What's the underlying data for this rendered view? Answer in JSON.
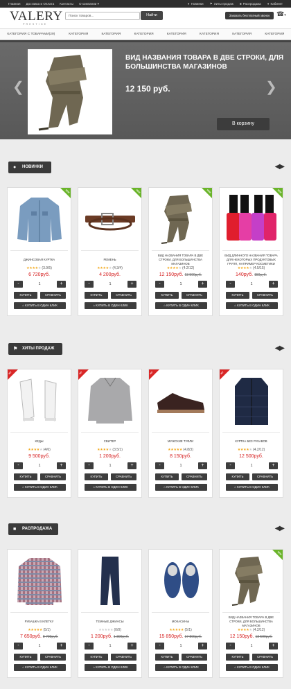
{
  "topbar": {
    "links": [
      "Главная",
      "Доставка и Оплата",
      "Контакты",
      "О компании ▾"
    ],
    "right": [
      "Новинки",
      "Хиты продаж",
      "Распродажа",
      "Кабинет"
    ]
  },
  "header": {
    "logo": "VALERY",
    "logo_sub": "PRESTIGE",
    "search_placeholder": "Поиск товаров...",
    "search_button": "Найти",
    "callback": "Заказать бесплатный звонок"
  },
  "nav": [
    "КАТЕГОРИЯ С ТОВАРАМИ(29)",
    "КАТЕГОРИЯ",
    "КАТЕГОРИЯ",
    "КАТЕГОРИЯ",
    "КАТЕГОРИЯ",
    "КАТЕГОРИЯ",
    "КАТЕГОРИЯ",
    "КАТЕГОРИЯ"
  ],
  "hero": {
    "title": "ВИД НАЗВАНИЯ ТОВАРА В ДВЕ СТРОКИ, ДЛЯ БОЛЬШИНСТВА МАГАЗИНОВ",
    "price": "12 150 руб.",
    "button": "В корзину"
  },
  "labels": {
    "minus": "-",
    "plus": "+",
    "buy": "КУПИТЬ",
    "compare": "СРАВНИТЬ",
    "one_click": "КУПИТЬ В ОДИН КЛИК",
    "new": "NEW",
    "hit": "HIT"
  },
  "sections": [
    {
      "title": "НОВИНКИ",
      "icon": "bell-icon",
      "ribbon": "new",
      "products": [
        {
          "name": "ДЖИНСОВАЯ КУРТКА",
          "stars": 4,
          "rating": "(3.9/5)",
          "price": "6 720руб.",
          "old": "",
          "qty": "1",
          "img": "jacket",
          "ribbon": true
        },
        {
          "name": "РЕМЕНЬ",
          "stars": 4,
          "rating": "(4,3/4)",
          "price": "4 200руб.",
          "old": "",
          "qty": "1",
          "img": "belt",
          "ribbon": true
        },
        {
          "name": "ВИД НАЗВАНИЯ ТОВАРА В ДВЕ СТРОКИ, ДЛЯ БОЛЬШИНСТВА МАГАЗИНОВ",
          "stars": 4,
          "rating": "(4.2/12)",
          "price": "12 150руб.",
          "old": "13 590руб.",
          "qty": "1",
          "img": "boot",
          "ribbon": true
        },
        {
          "name": "ВИД ДЛИННОГО НАЗВАНИЯ ТОВАРА ДЛЯ НЕКОТОРЫХ ПРОДУКТОВЫХ ГРУПП, НАПРИМЕР КОСМЕТИКИ",
          "stars": 4,
          "rating": "(4.5/15)",
          "price": "140руб.",
          "old": "150руб.",
          "qty": "1",
          "img": "polish",
          "ribbon": true
        }
      ]
    },
    {
      "title": "ХИТЫ ПРОДАЖ",
      "icon": "flag-icon",
      "ribbon": "hit",
      "products": [
        {
          "name": "КЕДЫ",
          "stars": 4,
          "rating": "(4/6)",
          "price": "9 500руб.",
          "old": "",
          "qty": "1",
          "img": "sneaker",
          "ribbon": true
        },
        {
          "name": "СВИТЕР",
          "stars": 4,
          "rating": "(3.5/1)",
          "price": "1 200руб.",
          "old": "",
          "qty": "1",
          "img": "sweater",
          "ribbon": true
        },
        {
          "name": "МУЖСКИЕ ТУФЛИ",
          "stars": 5,
          "rating": "(4.8/3)",
          "price": "8 150руб.",
          "old": "",
          "qty": "1",
          "img": "shoe",
          "ribbon": true
        },
        {
          "name": "КУРТКА БЕЗ РУКАВОВ",
          "stars": 4,
          "rating": "(4.2/12)",
          "price": "12 500руб.",
          "old": "",
          "qty": "1",
          "img": "vest",
          "ribbon": true
        }
      ]
    },
    {
      "title": "РАСПРОДАЖА",
      "icon": "bookmark-icon",
      "ribbon": "new",
      "products": [
        {
          "name": "РУБАШКА В КЛЕТКУ",
          "stars": 5,
          "rating": "(5/1)",
          "price": "7 650руб.",
          "old": "8 700руб.",
          "qty": "1",
          "img": "shirt",
          "ribbon": false
        },
        {
          "name": "ТЕМНЫЕ ДЖИНСЫ",
          "stars": 0,
          "rating": "(0/0)",
          "price": "1 200руб.",
          "old": "1 300руб.",
          "qty": "1",
          "img": "jeans",
          "ribbon": false
        },
        {
          "name": "МОКАСИНЫ",
          "stars": 5,
          "rating": "(5/1)",
          "price": "15 850руб.",
          "old": "17 800руб.",
          "qty": "1",
          "img": "loafer",
          "ribbon": false
        },
        {
          "name": "ВИД НАЗВАНИЯ ТОВАРА В ДВЕ СТРОКИ, ДЛЯ БОЛЬШИНСТВА МАГАЗИНОВ",
          "stars": 4,
          "rating": "(4.2/12)",
          "price": "12 150руб.",
          "old": "13 590руб.",
          "qty": "1",
          "img": "boot",
          "ribbon": true
        }
      ]
    }
  ]
}
